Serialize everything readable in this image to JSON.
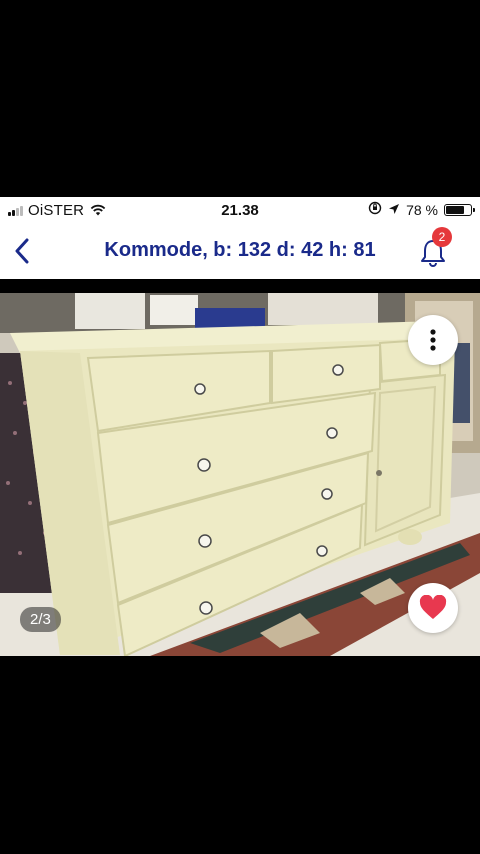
{
  "status_bar": {
    "carrier": "OiSTER",
    "time": "21.38",
    "battery_percent": "78 %",
    "battery_level": 0.78
  },
  "nav": {
    "title": "Kommode, b: 132 d: 42 h: 81",
    "notification_count": "2",
    "back_icon": "chevron-left-icon",
    "bell_icon": "bell-icon"
  },
  "gallery": {
    "counter": "2/3",
    "more_icon": "vertical-ellipsis-icon",
    "like_icon": "heart-icon"
  },
  "colors": {
    "nav_title": "#1a2a8a",
    "badge": "#e5383b",
    "heart": "#e8384f"
  }
}
